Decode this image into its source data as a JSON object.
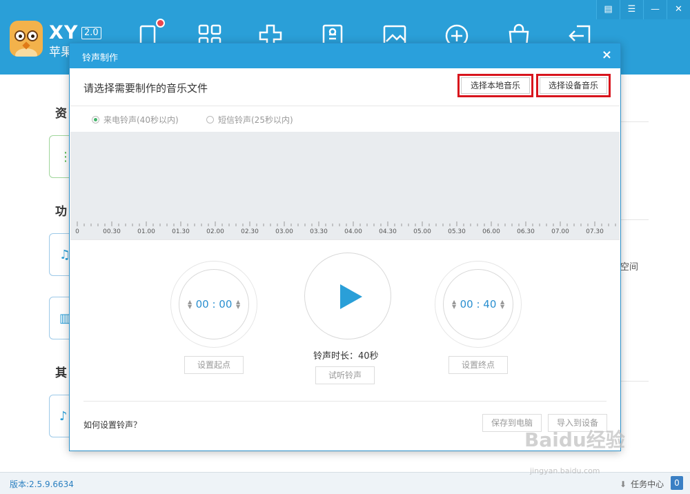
{
  "app": {
    "brand": "XY",
    "version_tag": "2.0",
    "subtitle": "苹果",
    "colors": {
      "primary": "#2a9fd8",
      "highlight": "#d8141c"
    }
  },
  "toolbar": {
    "icons": [
      "device-icon",
      "apps-icon",
      "games-icon",
      "ebooks-icon",
      "media-icon",
      "add-icon",
      "shop-icon",
      "import-icon"
    ]
  },
  "window_controls": {
    "menu": "▤",
    "settings": "☰",
    "minimize": "—",
    "close": "✕"
  },
  "background": {
    "sections": [
      "资",
      "功",
      "其"
    ],
    "side_text": "空间"
  },
  "status": {
    "version": "版本:2.5.9.6634",
    "task_center": "任务中心",
    "task_count": "0"
  },
  "dialog": {
    "title": "铃声制作",
    "close": "×",
    "heading": "请选择需要制作的音乐文件",
    "btn_local": "选择本地音乐",
    "btn_device": "选择设备音乐",
    "radio_call": "来电铃声(40秒以内)",
    "radio_sms": "短信铃声(25秒以内)",
    "ruler": [
      "0",
      "00.30",
      "01.00",
      "01.30",
      "02.00",
      "02.30",
      "03.00",
      "03.30",
      "04.00",
      "04.30",
      "05.00",
      "05.30",
      "06.00",
      "06.30",
      "07.00",
      "07.30"
    ],
    "start_time": "00 : 00",
    "end_time": "00 : 40",
    "btn_set_start": "设置起点",
    "btn_set_end": "设置终点",
    "duration": "铃声时长：40秒",
    "btn_preview": "试听铃声",
    "howto": "如何设置铃声？",
    "btn_save_pc": "保存到电脑",
    "btn_import": "导入到设备"
  },
  "watermark": {
    "main": "Baidu经验",
    "sub": "jingyan.baidu.com"
  }
}
